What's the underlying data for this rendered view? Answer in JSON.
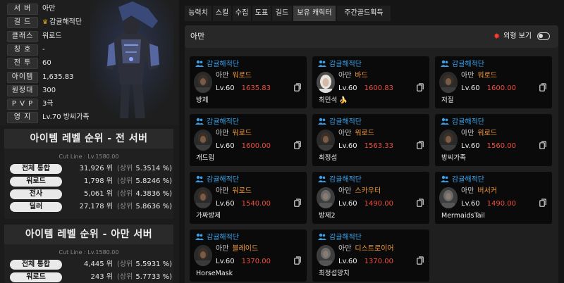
{
  "profile": {
    "rows": [
      {
        "label": "서 버",
        "value": "아만"
      },
      {
        "label": "길 드",
        "value": "감귤해적단",
        "crown": true
      },
      {
        "label": "클래스",
        "value": "워로드"
      },
      {
        "label": "칭 호",
        "value": "-"
      },
      {
        "label": "전 투",
        "value": "60"
      },
      {
        "label": "아이템",
        "value": "1,635.83"
      },
      {
        "label": "원정대",
        "value": "300"
      },
      {
        "label": "P V P",
        "value": "3극"
      },
      {
        "label": "영 지",
        "value": "Lv.70 방씨가족"
      }
    ]
  },
  "rank_all": {
    "title": "아이템 레벨 순위 - 전 서버",
    "cutline": "Cut Line : Lv.1580.00",
    "rows": [
      {
        "label": "전체 통합",
        "rank": "31,926 위",
        "prefix": "(상위",
        "pct": "5.3514 %)"
      },
      {
        "label": "워로드",
        "rank": "1,798 위",
        "prefix": "(상위",
        "pct": "5.8246 %)"
      },
      {
        "label": "전사",
        "rank": "5,061 위",
        "prefix": "(상위",
        "pct": "4.3836 %)"
      },
      {
        "label": "딜러",
        "rank": "27,178 위",
        "prefix": "(상위",
        "pct": "5.8636 %)"
      }
    ]
  },
  "rank_server": {
    "title": "아이템 레벨 순위 - 아만 서버",
    "cutline": "Cut Line : Lv.1580.00",
    "rows": [
      {
        "label": "전체 통합",
        "rank": "4,445 위",
        "prefix": "(상위",
        "pct": "5.5931 %)"
      },
      {
        "label": "워로드",
        "rank": "243 위",
        "prefix": "(상위",
        "pct": "5.7733 %)"
      }
    ]
  },
  "tabs": [
    "능력치",
    "스킬",
    "수집",
    "도표",
    "길드",
    "보유 캐릭터",
    "주간골드획득"
  ],
  "active_tab": "보유 캐릭터",
  "panel": {
    "title": "아만",
    "toggle_star": "✸",
    "toggle_label": "외형 보기"
  },
  "characters": [
    {
      "guild": "감귤해적단",
      "server": "아만",
      "class": "워로드",
      "level": "Lv.60",
      "ilvl": "1635.83",
      "name": "방제",
      "avatar": "dark"
    },
    {
      "guild": "감귤해적단",
      "server": "아만",
      "class": "바드",
      "level": "Lv.60",
      "ilvl": "1600.83",
      "name": "최민석",
      "name_icon": "🍌",
      "avatar": "light"
    },
    {
      "guild": "감귤해적단",
      "server": "아만",
      "class": "워로드",
      "level": "Lv.60",
      "ilvl": "1600.00",
      "name": "저질",
      "avatar": "dark"
    },
    {
      "guild": "감귤해적단",
      "server": "아만",
      "class": "워로드",
      "level": "Lv.60",
      "ilvl": "1600.00",
      "name": "개드립",
      "avatar": "dark"
    },
    {
      "guild": "감귤해적단",
      "server": "아만",
      "class": "워로드",
      "level": "Lv.60",
      "ilvl": "1563.33",
      "name": "최정섭",
      "avatar": "dark"
    },
    {
      "guild": "감귤해적단",
      "server": "아만",
      "class": "워로드",
      "level": "Lv.60",
      "ilvl": "1560.00",
      "name": "방씨가족",
      "avatar": "dark"
    },
    {
      "guild": "감귤해적단",
      "server": "아만",
      "class": "워로드",
      "level": "Lv.60",
      "ilvl": "1540.00",
      "name": "가짜방제",
      "avatar": "dark"
    },
    {
      "guild": "감귤해적단",
      "server": "아만",
      "class": "스카우터",
      "level": "Lv.60",
      "ilvl": "1490.00",
      "name": "방제2",
      "avatar": "gray"
    },
    {
      "guild": "감귤해적단",
      "server": "아만",
      "class": "버서커",
      "level": "Lv.60",
      "ilvl": "1490.00",
      "name": "MermaidsTail",
      "avatar": "gray"
    },
    {
      "guild": "감귤해적단",
      "server": "아만",
      "class": "블레이드",
      "level": "Lv.60",
      "ilvl": "1370.00",
      "name": "HorseMask",
      "avatar": "dark"
    },
    {
      "guild": "감귤해적단",
      "server": "아만",
      "class": "디스트로이어",
      "level": "Lv.60",
      "ilvl": "1370.00",
      "name": "최정섭망치",
      "avatar": "gray"
    }
  ]
}
